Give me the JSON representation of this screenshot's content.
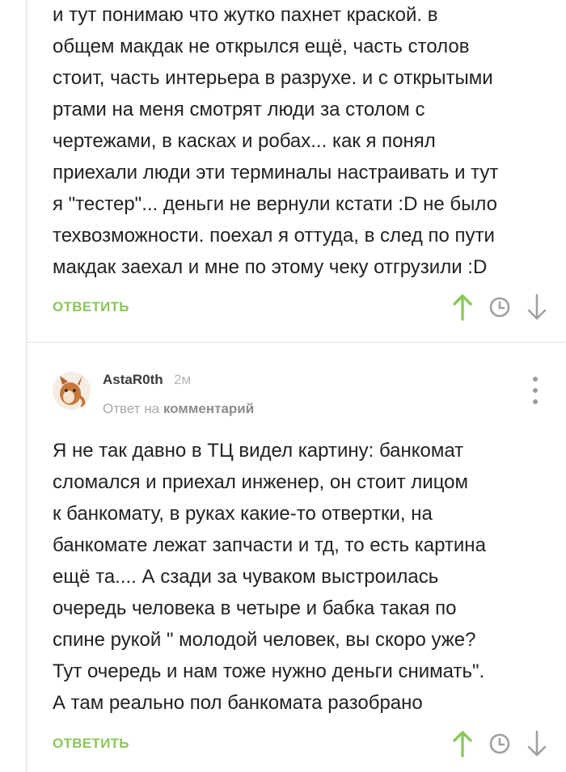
{
  "comment1": {
    "lines": [
      "и тут понимаю что жутко пахнет краской. в",
      "общем макдак не открылся ещё, часть столов",
      "стоит, часть интерьера в разрухе. и с открытыми",
      "ртами на меня смотрят люди за столом с",
      "чертежами, в касках и робах... как я понял",
      "приехали люди эти терминалы настраивать и тут",
      "я \"тестер\"... деньги не вернули кстати :D не было",
      "техвозможности. поехал я оттуда, в след по пути",
      "макдак заехал и мне по этому чеку отгрузили :D"
    ],
    "reply_label": "ОТВЕТИТЬ"
  },
  "comment2": {
    "author": "AstaR0th",
    "time": "2м",
    "reply_to_prefix": "Ответ на",
    "reply_to_target": "комментарий",
    "lines": [
      "Я не так давно в ТЦ видел картину: банкомат",
      "сломался и приехал инженер, он стоит лицом",
      "к банкомату, в руках какие-то отвертки, на",
      "банкомате лежат запчасти и тд, то есть картина",
      "ещё та.... А сзади за чуваком выстроилась",
      "очередь человека в четыре и бабка такая по",
      "спине рукой \" молодой человек, вы скоро уже?",
      "Тут очередь и нам тоже нужно деньги снимать\".",
      "А там реально пол банкомата разобрано"
    ],
    "reply_label": "ОТВЕТИТЬ"
  },
  "colors": {
    "accent_green": "#8ac858",
    "icon_gray": "#a0a0a0"
  },
  "icons": [
    "upvote-arrow-icon",
    "clock-icon",
    "downvote-arrow-icon",
    "more-vertical-icon"
  ]
}
